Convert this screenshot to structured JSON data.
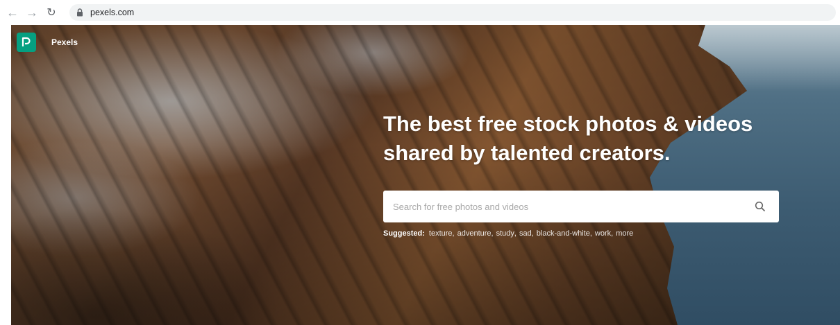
{
  "browser": {
    "url": "pexels.com",
    "icons": [
      "back-icon",
      "forward-icon",
      "reload-icon",
      "lock-icon"
    ]
  },
  "site": {
    "logo_text": "Pexels",
    "brand_color": "#05a081"
  },
  "hero": {
    "headline_line1": "The best free stock photos & videos",
    "headline_line2": "shared by talented creators."
  },
  "search": {
    "placeholder": "Search for free photos and videos",
    "icon": "search-icon"
  },
  "suggested": {
    "label": "Suggested:",
    "items": [
      "texture",
      "adventure",
      "study",
      "sad",
      "black-and-white",
      "work",
      "more"
    ]
  }
}
